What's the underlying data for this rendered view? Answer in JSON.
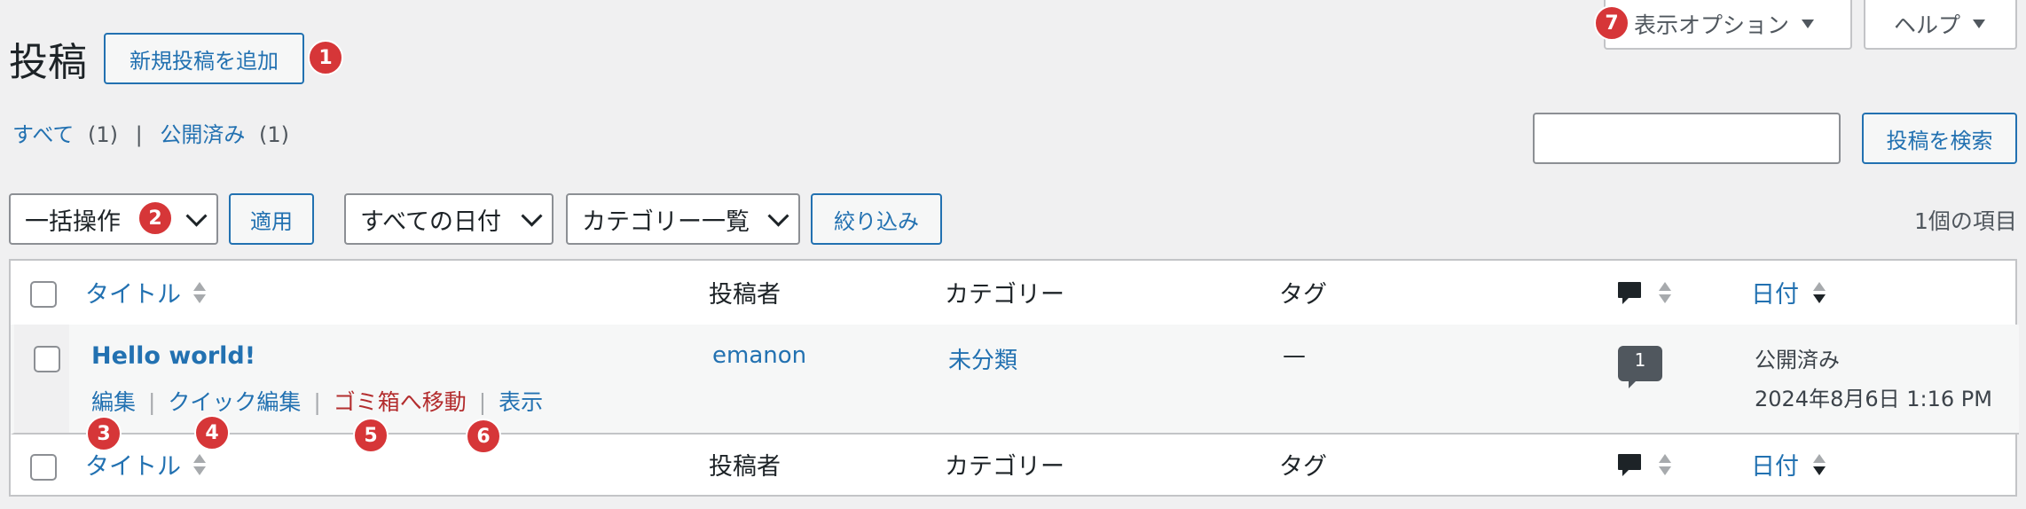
{
  "header": {
    "title": "投稿",
    "add_new_label": "新規投稿を追加"
  },
  "screen_options": {
    "label": "表示オプション",
    "help_label": "ヘルプ"
  },
  "subsubsub": {
    "all_label": "すべて",
    "all_count": "(1)",
    "published_label": "公開済み",
    "published_count": "(1)",
    "separator": "|"
  },
  "search": {
    "placeholder": "",
    "button_label": "投稿を検索"
  },
  "filters": {
    "bulk_actions": "一括操作",
    "apply_label": "適用",
    "all_dates": "すべての日付",
    "all_categories": "カテゴリー一覧",
    "filter_label": "絞り込み",
    "item_count": "1個の項目"
  },
  "table": {
    "columns": {
      "title": "タイトル",
      "author": "投稿者",
      "categories": "カテゴリー",
      "tags": "タグ",
      "date": "日付"
    },
    "rows": [
      {
        "title": "Hello world!",
        "author": "emanon",
        "category": "未分類",
        "tags": "—",
        "comments": "1",
        "status": "公開済み",
        "date": "2024年8月6日 1:16 PM",
        "actions": {
          "edit": "編集",
          "quick_edit": "クイック編集",
          "trash": "ゴミ箱へ移動",
          "view": "表示",
          "separator": "|"
        }
      }
    ]
  },
  "badges": [
    "1",
    "2",
    "3",
    "4",
    "5",
    "6",
    "7"
  ],
  "colors": {
    "accent": "#2271b1",
    "badge": "#d63638",
    "trash": "#b32d2e"
  },
  "icons": {
    "comment": "comment-bubble-icon",
    "sort": "sort-arrows-icon",
    "chevron": "chevron-down-icon"
  }
}
